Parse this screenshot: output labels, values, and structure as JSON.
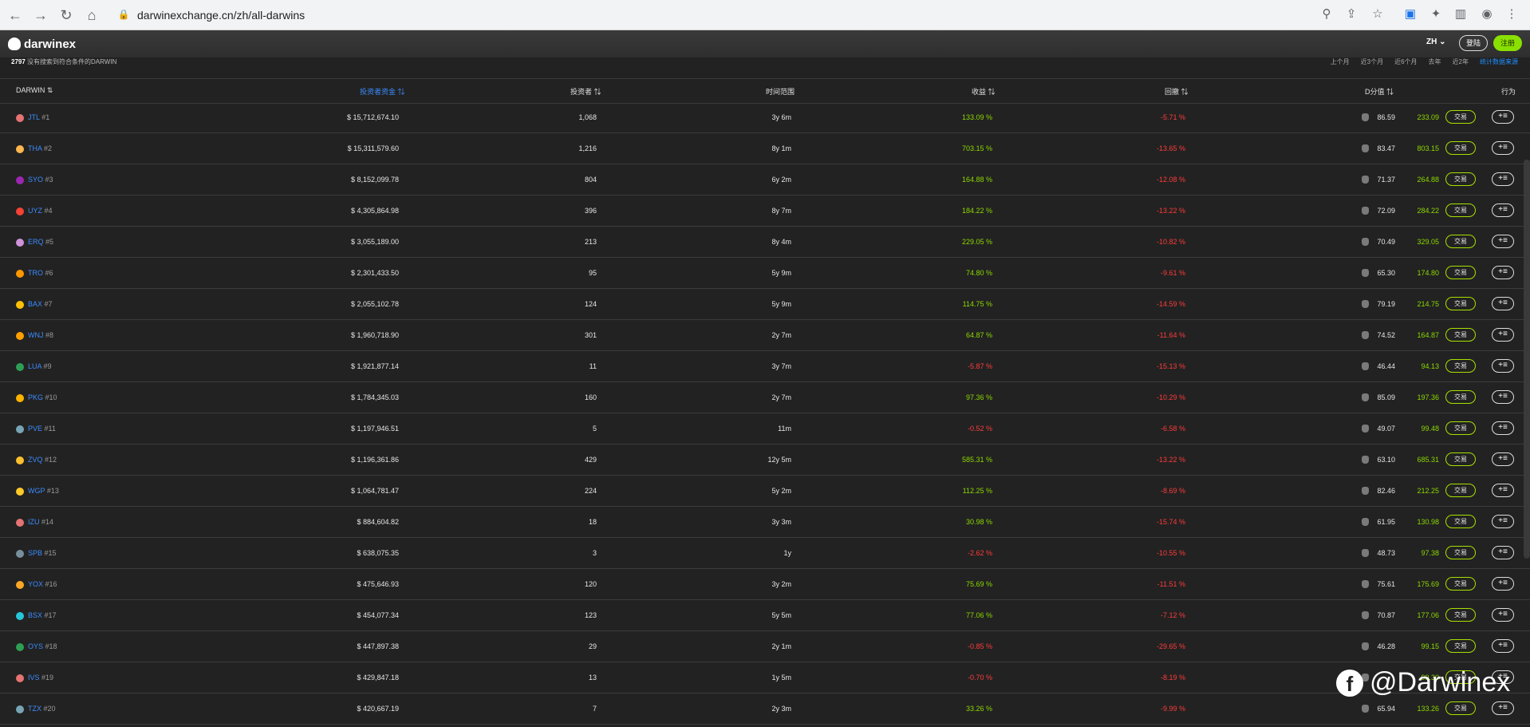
{
  "browser": {
    "url": "darwinexchange.cn/zh/all-darwins",
    "back_icon": "←",
    "forward_icon": "→",
    "reload_icon": "↻",
    "home_icon": "⌂",
    "lock_icon": "🔒"
  },
  "site": {
    "logo_text": "darwinex",
    "lang": "ZH",
    "login_label": "登陆",
    "signup_label": "注册"
  },
  "summary": {
    "count": "2797",
    "text": "没有搜索到符合条件的DARWIN"
  },
  "periods": [
    "上个月",
    "近3个月",
    "近6个月",
    "去年",
    "近2年",
    "统计数据来源"
  ],
  "columns": {
    "darwin": "DARWIN",
    "capital": "投资者资金",
    "investors": "投资者",
    "timeframe": "时间范围",
    "return": "收益",
    "drawdown": "回撤",
    "dscore": "D分值",
    "action": "行为"
  },
  "trade_label": "交易",
  "action_label": "+≡",
  "rows": [
    {
      "name": "JTL",
      "rank": "#1",
      "color": "#e57373",
      "capital": "$ 15,712,674.10",
      "investors": "1,068",
      "time": "3y 6m",
      "ret": "133.09 %",
      "ret_pos": true,
      "dd": "-5.71 %",
      "dscore": "86.59",
      "quote": "233.09"
    },
    {
      "name": "THA",
      "rank": "#2",
      "color": "#ffb74d",
      "capital": "$ 15,311,579.60",
      "investors": "1,216",
      "time": "8y 1m",
      "ret": "703.15 %",
      "ret_pos": true,
      "dd": "-13.65 %",
      "dscore": "83.47",
      "quote": "803.15"
    },
    {
      "name": "SYO",
      "rank": "#3",
      "color": "#9c27b0",
      "capital": "$ 8,152,099.78",
      "investors": "804",
      "time": "6y 2m",
      "ret": "164.88 %",
      "ret_pos": true,
      "dd": "-12.08 %",
      "dscore": "71.37",
      "quote": "264.88"
    },
    {
      "name": "UYZ",
      "rank": "#4",
      "color": "#f44336",
      "capital": "$ 4,305,864.98",
      "investors": "396",
      "time": "8y 7m",
      "ret": "184.22 %",
      "ret_pos": true,
      "dd": "-13.22 %",
      "dscore": "72.09",
      "quote": "284.22"
    },
    {
      "name": "ERQ",
      "rank": "#5",
      "color": "#ce93d8",
      "capital": "$ 3,055,189.00",
      "investors": "213",
      "time": "8y 4m",
      "ret": "229.05 %",
      "ret_pos": true,
      "dd": "-10.82 %",
      "dscore": "70.49",
      "quote": "329.05"
    },
    {
      "name": "TRO",
      "rank": "#6",
      "color": "#ff9800",
      "capital": "$ 2,301,433.50",
      "investors": "95",
      "time": "5y 9m",
      "ret": "74.80 %",
      "ret_pos": true,
      "dd": "-9.61 %",
      "dscore": "65.30",
      "quote": "174.80"
    },
    {
      "name": "BAX",
      "rank": "#7",
      "color": "#ffc107",
      "capital": "$ 2,055,102.78",
      "investors": "124",
      "time": "5y 9m",
      "ret": "114.75 %",
      "ret_pos": true,
      "dd": "-14.59 %",
      "dscore": "79.19",
      "quote": "214.75"
    },
    {
      "name": "WNJ",
      "rank": "#8",
      "color": "#ffa000",
      "capital": "$ 1,960,718.90",
      "investors": "301",
      "time": "2y 7m",
      "ret": "64.87 %",
      "ret_pos": true,
      "dd": "-11.64 %",
      "dscore": "74.52",
      "quote": "164.87"
    },
    {
      "name": "LUA",
      "rank": "#9",
      "color": "#2e9e55",
      "capital": "$ 1,921,877.14",
      "investors": "11",
      "time": "3y 7m",
      "ret": "-5.87 %",
      "ret_pos": false,
      "dd": "-15.13 %",
      "dscore": "46.44",
      "quote": "94.13"
    },
    {
      "name": "PKG",
      "rank": "#10",
      "color": "#ffb300",
      "capital": "$ 1,784,345.03",
      "investors": "160",
      "time": "2y 7m",
      "ret": "97.36 %",
      "ret_pos": true,
      "dd": "-10.29 %",
      "dscore": "85.09",
      "quote": "197.36"
    },
    {
      "name": "PVE",
      "rank": "#11",
      "color": "#78a5b5",
      "capital": "$ 1,197,946.51",
      "investors": "5",
      "time": "11m",
      "ret": "-0.52 %",
      "ret_pos": false,
      "dd": "-6.58 %",
      "dscore": "49.07",
      "quote": "99.48"
    },
    {
      "name": "ZVQ",
      "rank": "#12",
      "color": "#fbc02d",
      "capital": "$ 1,196,361.86",
      "investors": "429",
      "time": "12y 5m",
      "ret": "585.31 %",
      "ret_pos": true,
      "dd": "-13.22 %",
      "dscore": "63.10",
      "quote": "685.31"
    },
    {
      "name": "WGP",
      "rank": "#13",
      "color": "#ffca28",
      "capital": "$ 1,064,781.47",
      "investors": "224",
      "time": "5y 2m",
      "ret": "112.25 %",
      "ret_pos": true,
      "dd": "-8.69 %",
      "dscore": "82.46",
      "quote": "212.25"
    },
    {
      "name": "IZU",
      "rank": "#14",
      "color": "#e57373",
      "capital": "$ 884,604.82",
      "investors": "18",
      "time": "3y 3m",
      "ret": "30.98 %",
      "ret_pos": true,
      "dd": "-15.74 %",
      "dscore": "61.95",
      "quote": "130.98"
    },
    {
      "name": "SPB",
      "rank": "#15",
      "color": "#78909c",
      "capital": "$ 638,075.35",
      "investors": "3",
      "time": "1y",
      "ret": "-2.62 %",
      "ret_pos": false,
      "dd": "-10.55 %",
      "dscore": "48.73",
      "quote": "97.38"
    },
    {
      "name": "YOX",
      "rank": "#16",
      "color": "#ffa726",
      "capital": "$ 475,646.93",
      "investors": "120",
      "time": "3y 2m",
      "ret": "75.69 %",
      "ret_pos": true,
      "dd": "-11.51 %",
      "dscore": "75.61",
      "quote": "175.69"
    },
    {
      "name": "BSX",
      "rank": "#17",
      "color": "#26c6da",
      "capital": "$ 454,077.34",
      "investors": "123",
      "time": "5y 5m",
      "ret": "77.06 %",
      "ret_pos": true,
      "dd": "-7.12 %",
      "dscore": "70.87",
      "quote": "177.06"
    },
    {
      "name": "OYS",
      "rank": "#18",
      "color": "#2e9e55",
      "capital": "$ 447,897.38",
      "investors": "29",
      "time": "2y 1m",
      "ret": "-0.85 %",
      "ret_pos": false,
      "dd": "-29.65 %",
      "dscore": "46.28",
      "quote": "99.15"
    },
    {
      "name": "IVS",
      "rank": "#19",
      "color": "#e57373",
      "capital": "$ 429,847.18",
      "investors": "13",
      "time": "1y 5m",
      "ret": "-0.70 %",
      "ret_pos": false,
      "dd": "-8.19 %",
      "dscore": "",
      "quote": "99.30"
    },
    {
      "name": "TZX",
      "rank": "#20",
      "color": "#78a5b5",
      "capital": "$ 420,667.19",
      "investors": "7",
      "time": "2y 3m",
      "ret": "33.26 %",
      "ret_pos": true,
      "dd": "-9.99 %",
      "dscore": "65.94",
      "quote": "133.26"
    }
  ],
  "watermark": {
    "icon": "f",
    "text": "@Darwinex"
  }
}
